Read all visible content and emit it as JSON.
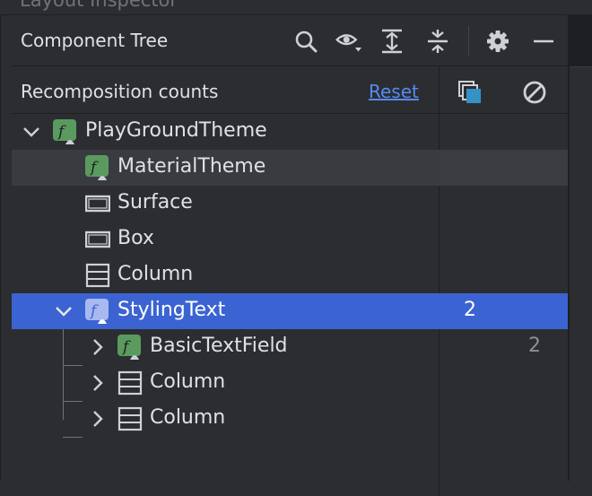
{
  "window": {
    "ghost_title": "Layout Inspector"
  },
  "header": {
    "title": "Component Tree",
    "icons": [
      "search-icon",
      "eye-icon",
      "expand-all-icon",
      "collapse-all-icon",
      "gear-icon",
      "minimize-icon"
    ]
  },
  "subheader": {
    "label": "Recomposition counts",
    "reset": "Reset",
    "icons": [
      "composition-count-icon",
      "skip-count-icon"
    ]
  },
  "colors": {
    "background": "#2b2d30",
    "selection": "#3b63d2",
    "link": "#548af7",
    "compose_icon_green": "#5b9a5f",
    "compose_icon_selected": "#a8b8f0"
  },
  "tree": {
    "rows": [
      {
        "name": "PlayGroundTheme",
        "icon": "compose-icon",
        "expanded": true
      },
      {
        "name": "MaterialTheme",
        "icon": "compose-icon"
      },
      {
        "name": "Surface",
        "icon": "surface-icon"
      },
      {
        "name": "Box",
        "icon": "box-icon"
      },
      {
        "name": "Column",
        "icon": "column-icon"
      },
      {
        "name": "StylingText",
        "icon": "compose-icon",
        "expanded": true,
        "selected": true,
        "count": "2"
      },
      {
        "name": "BasicTextField",
        "icon": "compose-icon",
        "expanded": false,
        "skip_count": "2"
      },
      {
        "name": "Column",
        "icon": "column-icon",
        "expanded": false
      },
      {
        "name": "Column",
        "icon": "column-icon",
        "expanded": false
      }
    ]
  }
}
